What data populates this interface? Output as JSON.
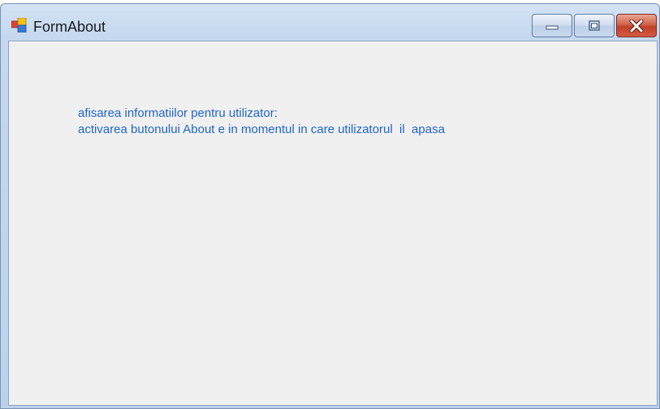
{
  "window": {
    "title": "FormAbout",
    "icon": "winforms-app-icon",
    "controls": {
      "minimize": "minimize-icon",
      "maximize": "maximize-icon",
      "close": "close-icon"
    }
  },
  "content": {
    "line1": "afisarea informatiilor pentru utilizator:",
    "line2": "activarea butonului About e in momentul in care utilizatorul  il  apasa"
  },
  "colors": {
    "text": "#1f66c8",
    "client_background": "#f0f0f0",
    "close_button": "#c8452d"
  }
}
